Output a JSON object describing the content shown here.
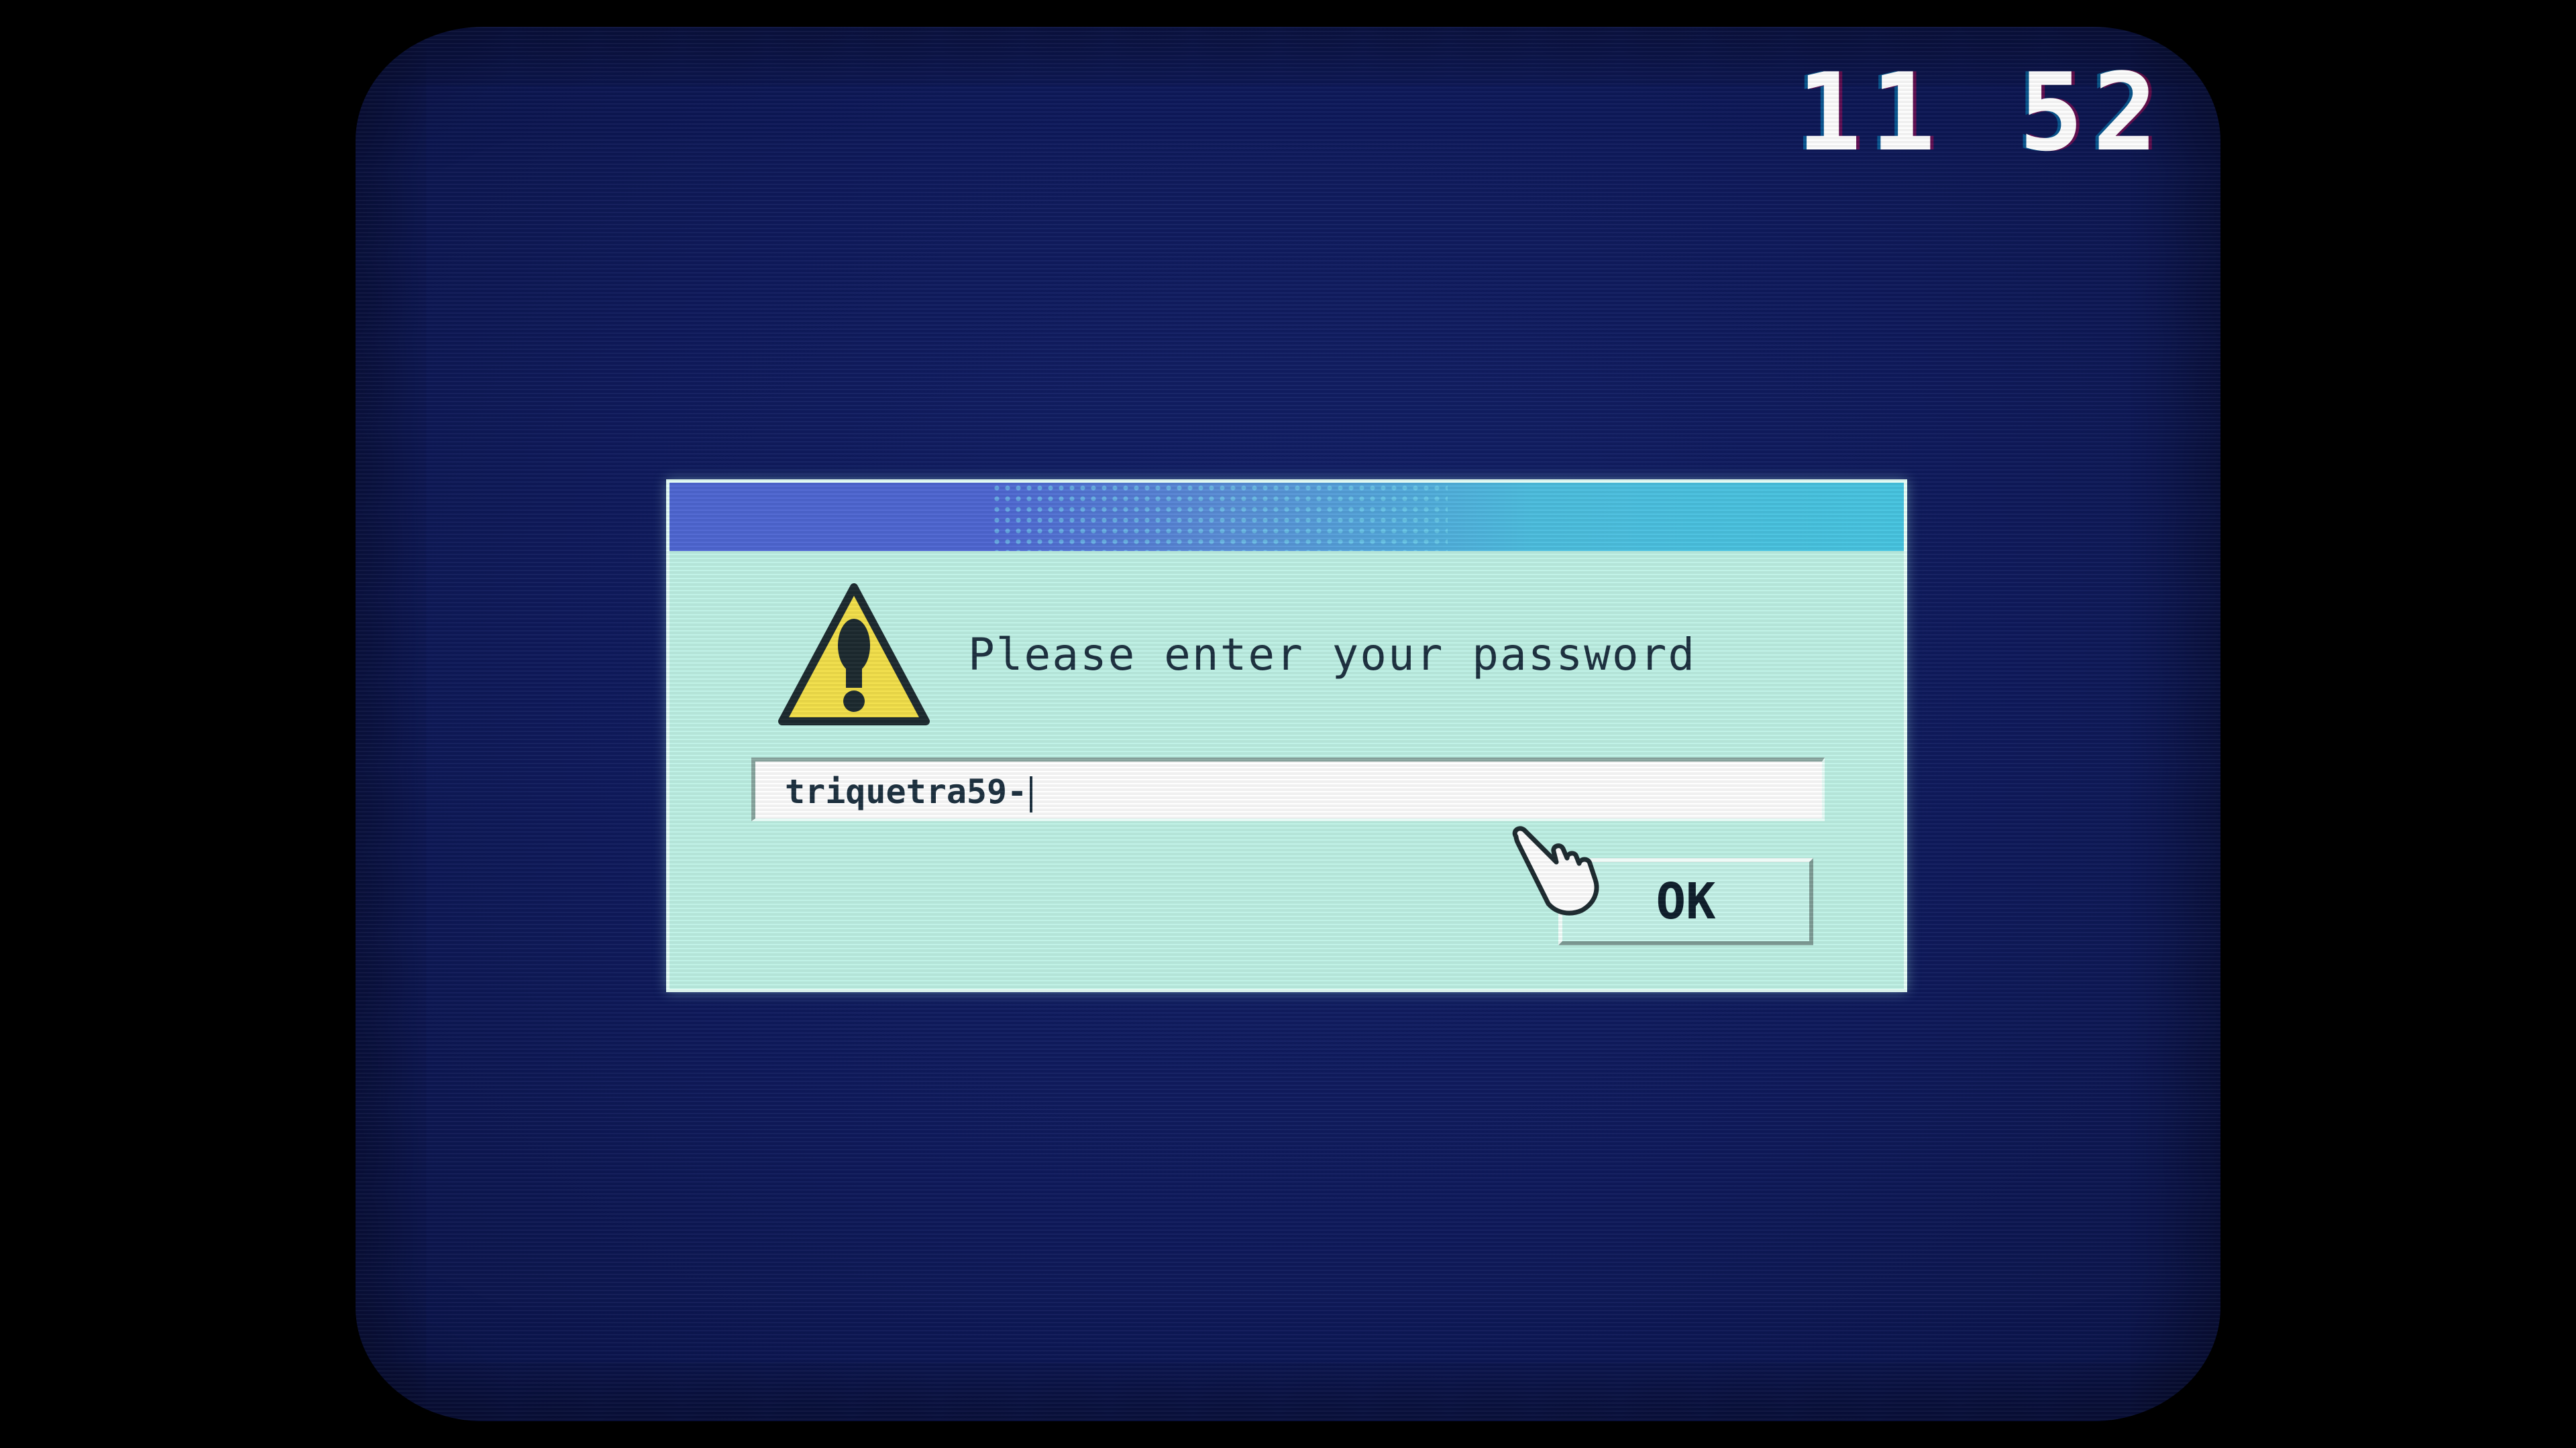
{
  "clock": {
    "time": "11 52"
  },
  "dialog": {
    "message": "Please enter your password",
    "icon": "warning-icon",
    "password_value": "triquetra59-",
    "ok_label": "OK"
  },
  "colors": {
    "screen_background": "#0f1a5c",
    "dialog_background": "#bff2e6",
    "titlebar_left": "#4f67d3",
    "titlebar_right": "#47c6e2",
    "warning_yellow": "#f4e14a",
    "text": "#1d3140"
  },
  "cursor": {
    "icon": "hand-pointer-cursor"
  }
}
